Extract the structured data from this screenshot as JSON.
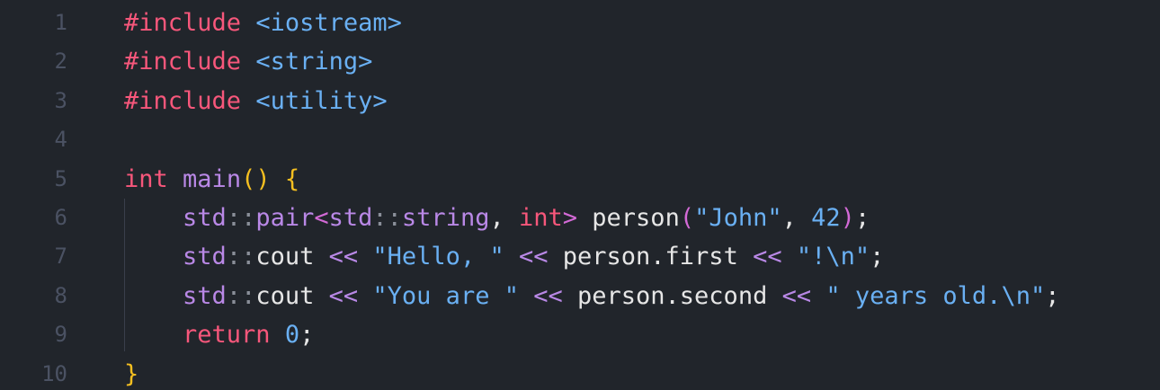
{
  "editor": {
    "line_numbers": [
      "1",
      "2",
      "3",
      "4",
      "5",
      "6",
      "7",
      "8",
      "9",
      "10"
    ],
    "lines": [
      [
        {
          "t": "#include",
          "k": "preproc"
        },
        {
          "t": " ",
          "k": "plain"
        },
        {
          "t": "<iostream>",
          "k": "header"
        }
      ],
      [
        {
          "t": "#include",
          "k": "preproc"
        },
        {
          "t": " ",
          "k": "plain"
        },
        {
          "t": "<string>",
          "k": "header"
        }
      ],
      [
        {
          "t": "#include",
          "k": "preproc"
        },
        {
          "t": " ",
          "k": "plain"
        },
        {
          "t": "<utility>",
          "k": "header"
        }
      ],
      [],
      [
        {
          "t": "int",
          "k": "kw"
        },
        {
          "t": " ",
          "k": "plain"
        },
        {
          "t": "main",
          "k": "func"
        },
        {
          "t": "()",
          "k": "paren"
        },
        {
          "t": " ",
          "k": "plain"
        },
        {
          "t": "{",
          "k": "brace"
        }
      ],
      [
        {
          "t": "    ",
          "k": "plain"
        },
        {
          "t": "std",
          "k": "ns"
        },
        {
          "t": "::",
          "k": "sep"
        },
        {
          "t": "pair",
          "k": "ns"
        },
        {
          "t": "<",
          "k": "pink"
        },
        {
          "t": "std",
          "k": "ns"
        },
        {
          "t": "::",
          "k": "sep"
        },
        {
          "t": "string",
          "k": "ns"
        },
        {
          "t": ", ",
          "k": "plain"
        },
        {
          "t": "int",
          "k": "kw"
        },
        {
          "t": ">",
          "k": "pink"
        },
        {
          "t": " person",
          "k": "plain"
        },
        {
          "t": "(",
          "k": "pink"
        },
        {
          "t": "\"John\"",
          "k": "string"
        },
        {
          "t": ", ",
          "k": "plain"
        },
        {
          "t": "42",
          "k": "num"
        },
        {
          "t": ")",
          "k": "pink"
        },
        {
          "t": ";",
          "k": "plain"
        }
      ],
      [
        {
          "t": "    ",
          "k": "plain"
        },
        {
          "t": "std",
          "k": "ns"
        },
        {
          "t": "::",
          "k": "sep"
        },
        {
          "t": "cout",
          "k": "plain"
        },
        {
          "t": " ",
          "k": "plain"
        },
        {
          "t": "<<",
          "k": "op"
        },
        {
          "t": " ",
          "k": "plain"
        },
        {
          "t": "\"Hello, \"",
          "k": "string"
        },
        {
          "t": " ",
          "k": "plain"
        },
        {
          "t": "<<",
          "k": "op"
        },
        {
          "t": " person.first ",
          "k": "plain"
        },
        {
          "t": "<<",
          "k": "op"
        },
        {
          "t": " ",
          "k": "plain"
        },
        {
          "t": "\"!\\n\"",
          "k": "string"
        },
        {
          "t": ";",
          "k": "plain"
        }
      ],
      [
        {
          "t": "    ",
          "k": "plain"
        },
        {
          "t": "std",
          "k": "ns"
        },
        {
          "t": "::",
          "k": "sep"
        },
        {
          "t": "cout",
          "k": "plain"
        },
        {
          "t": " ",
          "k": "plain"
        },
        {
          "t": "<<",
          "k": "op"
        },
        {
          "t": " ",
          "k": "plain"
        },
        {
          "t": "\"You are \"",
          "k": "string"
        },
        {
          "t": " ",
          "k": "plain"
        },
        {
          "t": "<<",
          "k": "op"
        },
        {
          "t": " person.second ",
          "k": "plain"
        },
        {
          "t": "<<",
          "k": "op"
        },
        {
          "t": " ",
          "k": "plain"
        },
        {
          "t": "\" years old.\\n\"",
          "k": "string"
        },
        {
          "t": ";",
          "k": "plain"
        }
      ],
      [
        {
          "t": "    ",
          "k": "plain"
        },
        {
          "t": "return",
          "k": "kw"
        },
        {
          "t": " ",
          "k": "plain"
        },
        {
          "t": "0",
          "k": "num"
        },
        {
          "t": ";",
          "k": "plain"
        }
      ],
      [
        {
          "t": "}",
          "k": "brace"
        }
      ]
    ]
  },
  "colors": {
    "background": "#21252b",
    "line_number": "#4b5263",
    "preproc": "#f7577b",
    "header": "#6ab0f3",
    "keyword": "#f7577b",
    "function": "#b988e6",
    "brace": "#f5bf20",
    "string": "#6ab0f3",
    "number": "#6ab0f3"
  }
}
